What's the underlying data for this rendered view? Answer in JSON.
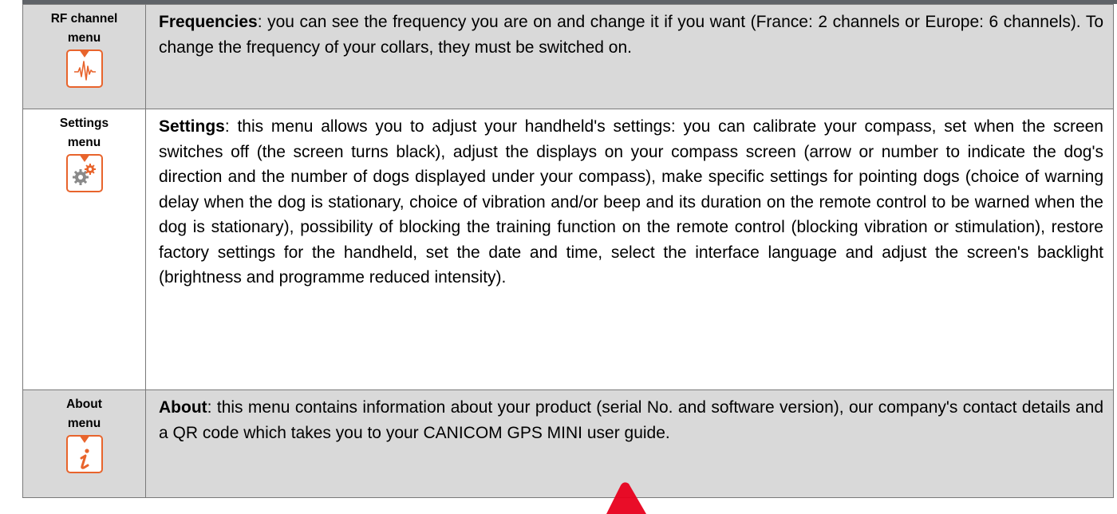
{
  "rows": [
    {
      "menu_label_1": "RF channel",
      "menu_label_2": "menu",
      "icon": "waveform-icon",
      "term": "Frequencies",
      "text": ": you can see the frequency you are on and change it if you want (France: 2 channels or Europe: 6 channels). To change the frequency of your collars, they must be switched on."
    },
    {
      "menu_label_1": "Settings",
      "menu_label_2": "menu",
      "icon": "gears-icon",
      "term": "Settings",
      "text": ": this menu allows you to adjust your handheld's settings: you can calibrate your compass, set when the screen switches off (the screen turns black), adjust the displays on your compass screen (arrow or number to indicate the dog's direction and the number of dogs displayed under your compass), make specific settings for pointing dogs (choice of warning delay when the dog is stationary, choice of vibration and/or beep and its duration on the remote control to be warned when the dog is stationary), possibility of blocking the training function on the remote control (blocking vibration or stimulation), restore factory settings for the handheld, set the date and time, select the interface language and adjust the screen's backlight (brightness and programme reduced intensity)."
    },
    {
      "menu_label_1": "About",
      "menu_label_2": "menu",
      "icon": "info-icon",
      "term": "About",
      "text": ": this menu contains information about your product (serial No. and software version), our company's contact details and a QR code which takes you to your CANICOM GPS MINI user guide."
    }
  ],
  "colors": {
    "accent": "#e8642c",
    "shade": "#d9d9d9",
    "rule": "#5f6368",
    "watermark": "#e8001c"
  }
}
